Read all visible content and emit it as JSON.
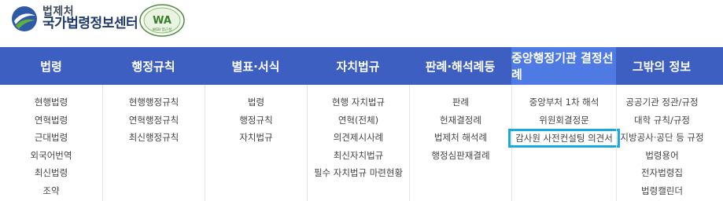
{
  "header": {
    "logo_line1": "법제처",
    "logo_line2": "국가법령정보센터",
    "wa_badge_text": "WA",
    "wa_badge_sub": "WEB 접근성"
  },
  "nav": [
    {
      "label": "법령",
      "active": false,
      "items": [
        "현행법령",
        "연혁법령",
        "근대법령",
        "외국어번역",
        "최신법령",
        "조약"
      ]
    },
    {
      "label": "행정규칙",
      "active": false,
      "items": [
        "현행행정규칙",
        "연혁행정규칙",
        "최신행정규칙"
      ]
    },
    {
      "label": "별표·서식",
      "active": false,
      "items": [
        "법령",
        "행정규칙",
        "자치법규"
      ]
    },
    {
      "label": "자치법규",
      "active": false,
      "items": [
        "현행 자치법규",
        "연혁(전체)",
        "의견제시사례",
        "최신자치법규",
        "필수 자치법규 마련현황"
      ]
    },
    {
      "label": "판례·해석례등",
      "active": false,
      "items": [
        "판례",
        "헌재결정례",
        "법제처 해석례",
        "행정심판재결례"
      ]
    },
    {
      "label": "중앙행정기관 결정선례",
      "active": true,
      "items": [
        "중앙부처 1차 해석",
        "위원회결정문",
        "감사원 사전컨설팅 의견서"
      ]
    },
    {
      "label": "그밖의 정보",
      "active": false,
      "items": [
        "공공기관 정관/규정",
        "대학 규칙/규정",
        "지방공사·공단 등 규정",
        "법령용어",
        "전자법령집",
        "법령캘린더"
      ]
    }
  ],
  "colors": {
    "nav_bg": "#3d5fc2",
    "nav_active_bg": "#4f79e3",
    "highlight_border": "#1aa8e0"
  }
}
